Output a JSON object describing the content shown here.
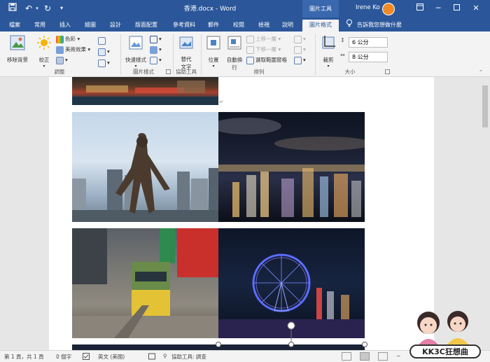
{
  "titlebar": {
    "doc_title": "香港.docx - Word",
    "context_tool": "圖片工具",
    "user_name": "Irene Ko",
    "qat": [
      "save-icon",
      "undo-icon",
      "redo-icon",
      "customize-icon"
    ],
    "window_buttons": [
      "ribbon-display-icon",
      "minimize-icon",
      "restore-icon",
      "close-icon"
    ]
  },
  "tabs": [
    {
      "label": "檔案"
    },
    {
      "label": "常用"
    },
    {
      "label": "插入"
    },
    {
      "label": "繪圖"
    },
    {
      "label": "設計"
    },
    {
      "label": "版面配置"
    },
    {
      "label": "參考資料"
    },
    {
      "label": "郵件"
    },
    {
      "label": "校閱"
    },
    {
      "label": "檢視"
    },
    {
      "label": "說明"
    },
    {
      "label": "圖片格式"
    }
  ],
  "tell_me": "告訴我您想做什麼",
  "ribbon": {
    "remove_bg": "移除背景",
    "corrections": "校正",
    "color": "色彩",
    "artistic": "美術效果",
    "group_adjust": "調整",
    "quick_styles": "快速樣式",
    "group_styles": "圖片樣式",
    "alt_text_1": "替代",
    "alt_text_2": "文字",
    "group_access": "協助工具",
    "position": "位置",
    "wrap_1": "自動換",
    "wrap_2": "行",
    "bring_forward": "上移一層",
    "send_backward": "下移一層",
    "selection_pane": "選取範圍窗格",
    "group_arrange": "排列",
    "crop": "裁剪",
    "height": "6 公分",
    "width": "8 公分",
    "group_size": "大小"
  },
  "statusbar": {
    "page": "第 1 頁，共 1 頁",
    "words": "0 個字",
    "language": "英文 (美國)",
    "accessibility": "協助工具: 調查"
  },
  "watermark": "KK3C狂想曲"
}
